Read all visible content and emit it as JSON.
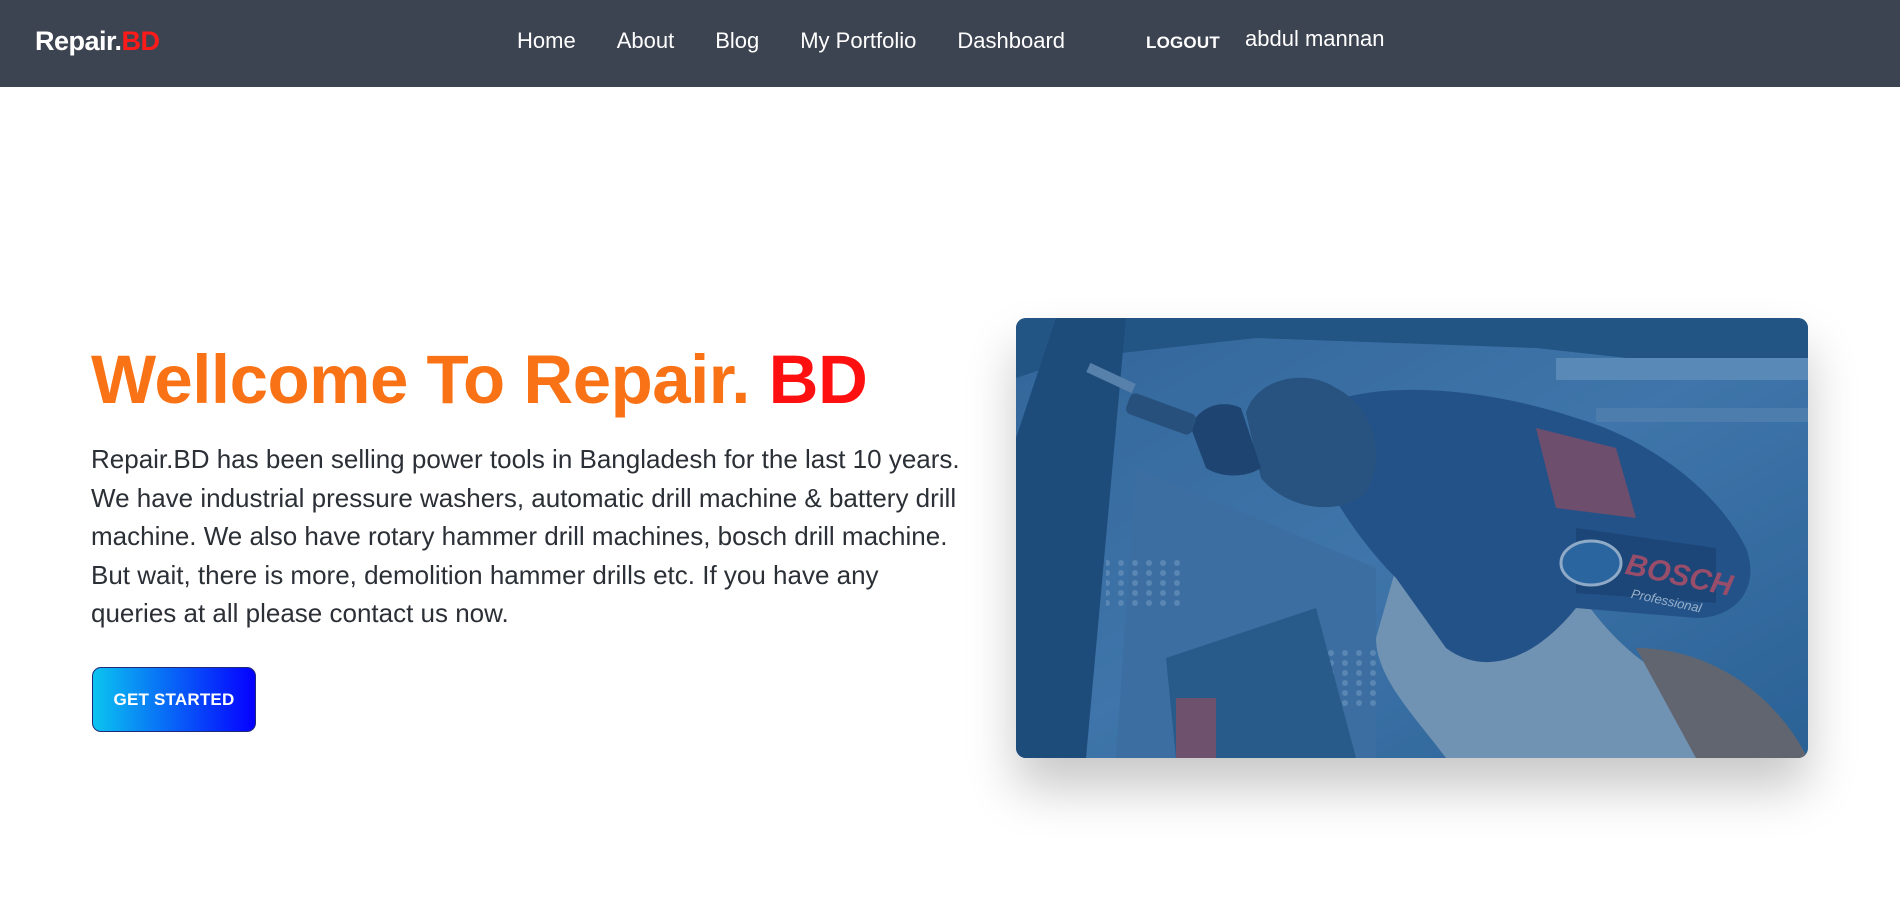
{
  "navbar": {
    "brand_main": "Repair.",
    "brand_accent": "BD",
    "links": [
      "Home",
      "About",
      "Blog",
      "My Portfolio",
      "Dashboard"
    ],
    "logout_label": "LOGOUT",
    "username": "abdul mannan"
  },
  "hero": {
    "title_main": "Wellcome To Repair. ",
    "title_accent": "BD",
    "description": "Repair.BD has been selling power tools in Bangladesh for the last 10 years. We have industrial pressure washers, automatic drill machine & battery drill machine. We also have rotary hammer drill machines, bosch drill machine. But wait, there is more, demolition hammer drills etc. If you have any queries at all please contact us now.",
    "cta_label": "GET STARTED",
    "image_brand_text": "BOSCH",
    "image_sub_text": "Professional"
  },
  "colors": {
    "navbar_bg": "#3d4451",
    "brand_accent": "#ff1a1a",
    "title_orange": "#f97316",
    "title_red": "#ff1010",
    "cta_gradient_start": "#0bc4f0",
    "cta_gradient_end": "#0500ff",
    "image_overlay": "#1f5b94"
  },
  "icons": {
    "hero_image": "power-drill-photo"
  }
}
